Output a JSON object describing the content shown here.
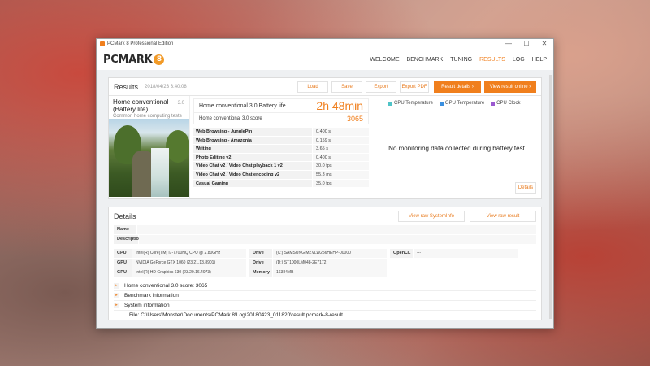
{
  "window": {
    "title": "PCMark 8 Professional Edition",
    "controls": [
      "—",
      "☐",
      "✕"
    ]
  },
  "app": {
    "logo_text": "PCMARK",
    "logo_badge": "8",
    "nav": [
      "WELCOME",
      "BENCHMARK",
      "TUNING",
      "RESULTS",
      "LOG",
      "HELP"
    ],
    "active_nav": "RESULTS",
    "accent_color": "#f07f1d"
  },
  "results": {
    "title": "Results",
    "date": "2018/04/23 3:40:08",
    "buttons": {
      "load": "Load",
      "save": "Save",
      "export": "Export",
      "export_pdf": "Export PDF",
      "result_details": "Result details",
      "view_online": "View result online"
    },
    "test": {
      "name": "Home conventional (Battery life)",
      "version": "3.0",
      "subtitle": "Common home computing tests"
    },
    "main_score": {
      "label": "Home conventional 3.0 Battery life",
      "value": "2h 48min"
    },
    "secondary_score": {
      "label": "Home conventional 3.0 score",
      "value": "3065"
    },
    "subtests": [
      {
        "name": "Web Browsing - JunglePin",
        "value": "0.400 s"
      },
      {
        "name": "Web Browsing - Amazonia",
        "value": "0.159 s"
      },
      {
        "name": "Writing",
        "value": "3.65 s"
      },
      {
        "name": "Photo Editing v2",
        "value": "0.400 s"
      },
      {
        "name": "Video Chat v2 / Video Chat playback 1 v2",
        "value": "30.0 fps"
      },
      {
        "name": "Video Chat v2 / Video Chat encoding v2",
        "value": "55.3 ms"
      },
      {
        "name": "Casual Gaming",
        "value": "35.0 fps"
      }
    ],
    "monitoring": {
      "legend": [
        {
          "label": "CPU Temperature",
          "color": "#4fc3c7"
        },
        {
          "label": "GPU Temperature",
          "color": "#3a8fe0"
        },
        {
          "label": "CPU Clock",
          "color": "#9b59d0"
        }
      ],
      "message": "No monitoring data collected during battery test",
      "details_button": "Details"
    }
  },
  "details": {
    "title": "Details",
    "view_sysinfo": "View raw SystemInfo",
    "view_raw": "View raw result",
    "name_label": "Name",
    "description_label": "Description",
    "cpu_label": "CPU",
    "cpu_value": "Intel(R) Core(TM) i7-7700HQ CPU @ 2.80GHz",
    "gpu1_label": "GPU",
    "gpu1_value": "NVIDIA GeForce GTX 1060 (23.21.13.8901)",
    "gpu2_label": "GPU",
    "gpu2_value": "Intel(R) HD Graphics 630 (23.20.16.4973)",
    "drive1_label": "Drive",
    "drive1_value": "(C:) SAMSUNG MZVLW256HEHP-00000",
    "drive2_label": "Drive",
    "drive2_value": "(D:) ST1000LM048-2E7172",
    "memory_label": "Memory",
    "memory_value": "16384MB",
    "opencl_label": "OpenCL",
    "opencl_value": "---",
    "expanders": [
      "Home conventional 3.0 score: 3065",
      "Benchmark information",
      "System information"
    ],
    "file": "File: C:\\Users\\Monster\\Documents\\PCMark 8\\Log\\20180423_011820\\result.pcmark-8-result"
  }
}
